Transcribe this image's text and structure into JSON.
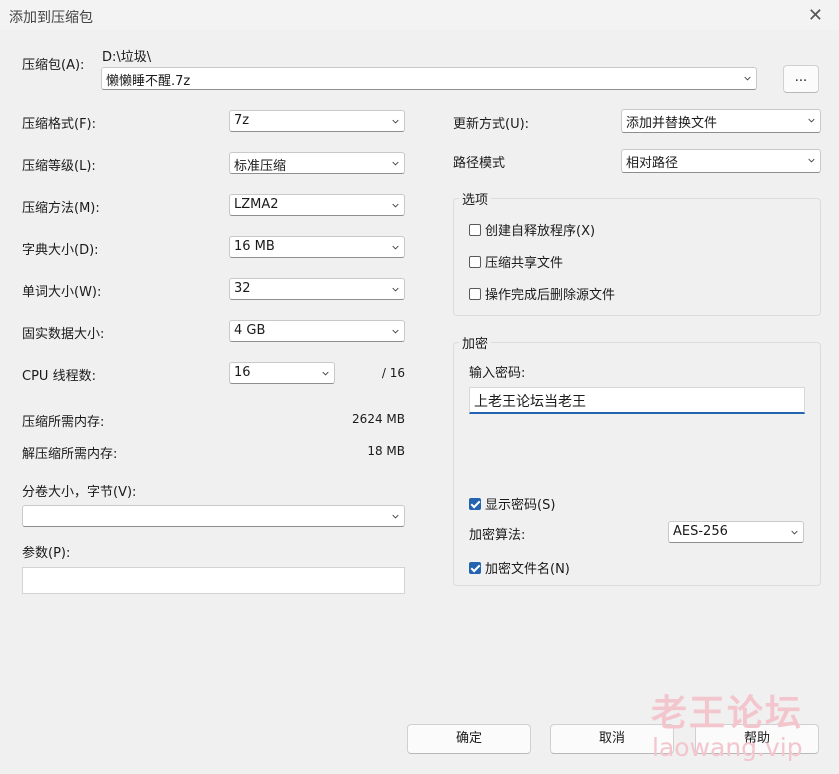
{
  "window": {
    "title": "添加到压缩包"
  },
  "archive": {
    "label": "压缩包(A):",
    "path": "D:\\垃圾\\",
    "filename": "懒懒睡不醒.7z",
    "browse_label": "..."
  },
  "left": {
    "format": {
      "label": "压缩格式(F):",
      "value": "7z"
    },
    "level": {
      "label": "压缩等级(L):",
      "value": "标准压缩"
    },
    "method": {
      "label": "压缩方法(M):",
      "value": "LZMA2"
    },
    "dict": {
      "label": "字典大小(D):",
      "value": "16 MB"
    },
    "word": {
      "label": "单词大小(W):",
      "value": "32"
    },
    "solid": {
      "label": "固实数据大小:",
      "value": "4 GB"
    },
    "threads": {
      "label": "CPU 线程数:",
      "value": "16",
      "max": "/ 16"
    },
    "mem_compress": {
      "label": "压缩所需内存:",
      "value": "2624 MB"
    },
    "mem_decompress": {
      "label": "解压缩所需内存:",
      "value": "18 MB"
    },
    "volume": {
      "label": "分卷大小，字节(V):",
      "value": ""
    },
    "params": {
      "label": "参数(P):",
      "value": ""
    }
  },
  "right": {
    "update": {
      "label": "更新方式(U):",
      "value": "添加并替换文件"
    },
    "path_mode": {
      "label": "路径模式",
      "value": "相对路径"
    },
    "options": {
      "title": "选项",
      "sfx": {
        "label": "创建自释放程序(X)",
        "checked": false
      },
      "shared": {
        "label": "压缩共享文件",
        "checked": false
      },
      "delete": {
        "label": "操作完成后删除源文件",
        "checked": false
      }
    },
    "encrypt": {
      "title": "加密",
      "pw_label": "输入密码:",
      "pw_value": "上老王论坛当老王",
      "show_pw": {
        "label": "显示密码(S)",
        "checked": true
      },
      "algo_label": "加密算法:",
      "algo_value": "AES-256",
      "enc_names": {
        "label": "加密文件名(N)",
        "checked": true
      }
    }
  },
  "buttons": {
    "ok": "确定",
    "cancel": "取消",
    "help": "帮助"
  },
  "watermark": {
    "line1": "老王论坛",
    "line2": "laowang.vip"
  }
}
